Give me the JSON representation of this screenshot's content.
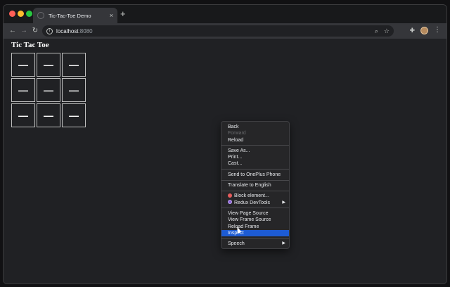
{
  "browser": {
    "tab_title": "Tic-Tac-Toe Demo",
    "tab_close": "×",
    "new_tab": "+",
    "url_host": "localhost",
    "url_port": ":8080",
    "icons": {
      "back": "←",
      "forward": "→",
      "reload": "↻",
      "info": "i",
      "zoom": "⌕",
      "star": "☆",
      "extensions": "✚",
      "menu": "⋮"
    }
  },
  "page": {
    "title": "Tic Tac Toe",
    "cells": [
      "—",
      "—",
      "—",
      "—",
      "—",
      "—",
      "—",
      "—",
      "—"
    ]
  },
  "context_menu": {
    "groups": [
      [
        "Back",
        "Forward",
        "Reload"
      ],
      [
        "Save As...",
        "Print...",
        "Cast..."
      ],
      [
        "Send to OnePlus Phone"
      ],
      [
        "Translate to English"
      ],
      [
        "Block element...",
        "Redux DevTools"
      ],
      [
        "View Page Source",
        "View Frame Source",
        "Reload Frame",
        "Inspect"
      ],
      [
        "Speech"
      ]
    ],
    "submenu_arrow": "▶",
    "disabled": [
      "Forward"
    ],
    "highlighted": "Inspect",
    "highlight_color": "#1d5bd4"
  }
}
